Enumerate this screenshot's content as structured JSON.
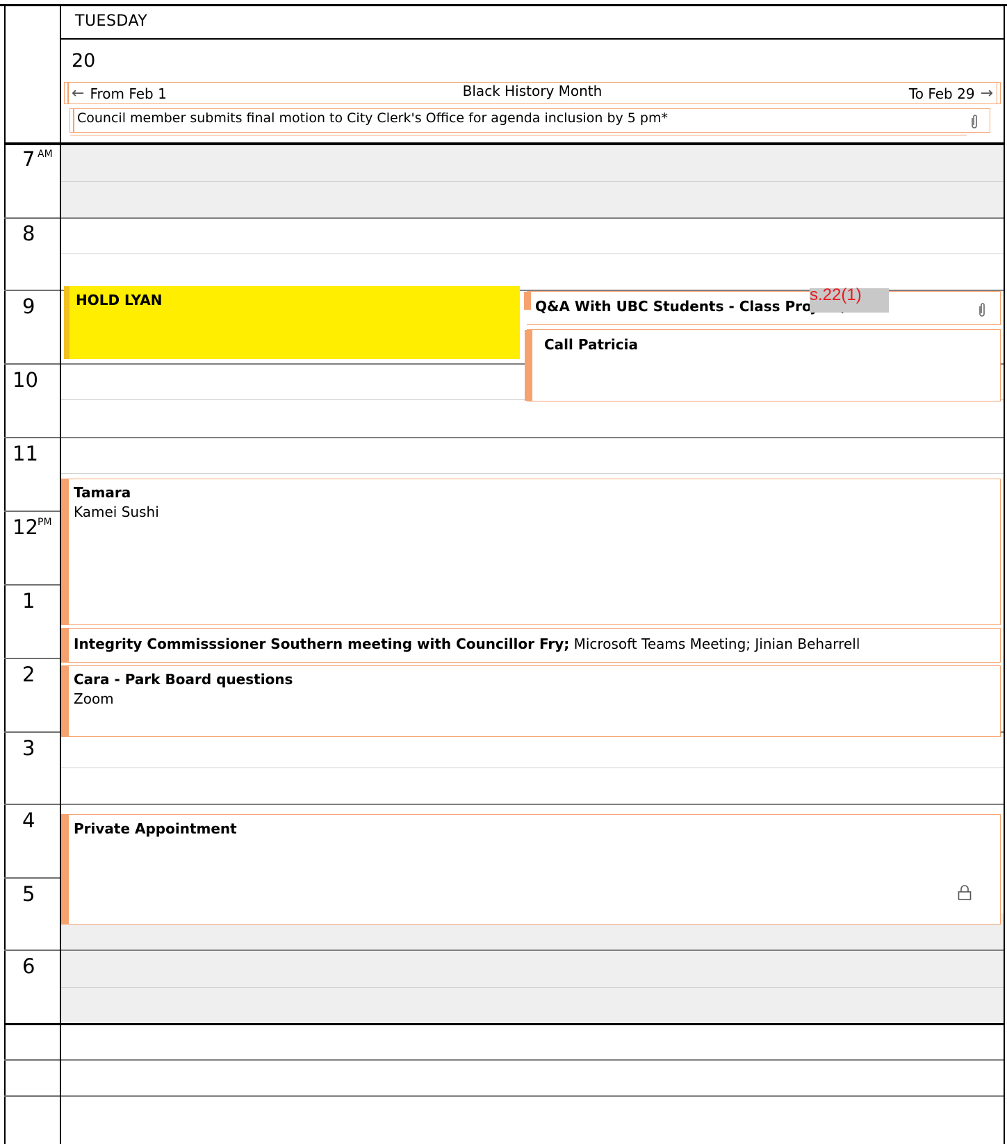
{
  "header": {
    "day_name": "TUESDAY",
    "date_number": "20"
  },
  "all_day": {
    "banner": {
      "prev_label": "From Feb 1",
      "title": "Black History Month",
      "next_label": "To Feb 29"
    },
    "event": {
      "text": "Council member submits final motion to City Clerk's Office for agenda inclusion by 5 pm*",
      "has_attachment": true
    }
  },
  "hours": [
    {
      "number": "7",
      "ampm": "AM"
    },
    {
      "number": "8",
      "ampm": ""
    },
    {
      "number": "9",
      "ampm": ""
    },
    {
      "number": "10",
      "ampm": ""
    },
    {
      "number": "11",
      "ampm": ""
    },
    {
      "number": "12",
      "ampm": "PM"
    },
    {
      "number": "1",
      "ampm": ""
    },
    {
      "number": "2",
      "ampm": ""
    },
    {
      "number": "3",
      "ampm": ""
    },
    {
      "number": "4",
      "ampm": ""
    },
    {
      "number": "5",
      "ampm": ""
    },
    {
      "number": "6",
      "ampm": ""
    }
  ],
  "events": {
    "hold_lyan": {
      "title": "HOLD LYAN",
      "color": "#ffee00"
    },
    "qa_ubc": {
      "title": "Q&A With UBC Students - Class Project;",
      "redaction_label": "s.22(1)",
      "has_attachment": true
    },
    "call_patricia": {
      "title": "Call Patricia"
    },
    "tamara": {
      "title": "Tamara",
      "location": "Kamei Sushi"
    },
    "integrity": {
      "title": "Integrity Commisssioner Southern meeting with Councillor Fry;",
      "details": " Microsoft Teams Meeting; Jinian Beharrell"
    },
    "cara": {
      "title": "Cara - Park Board questions",
      "location": "Zoom"
    },
    "private": {
      "title": "Private Appointment",
      "is_private": true
    }
  },
  "colors": {
    "event_border": "#f6a26f",
    "hold_fill": "#ffee00",
    "off_hours_fill": "#efefef",
    "redaction_text": "#e8191f"
  }
}
